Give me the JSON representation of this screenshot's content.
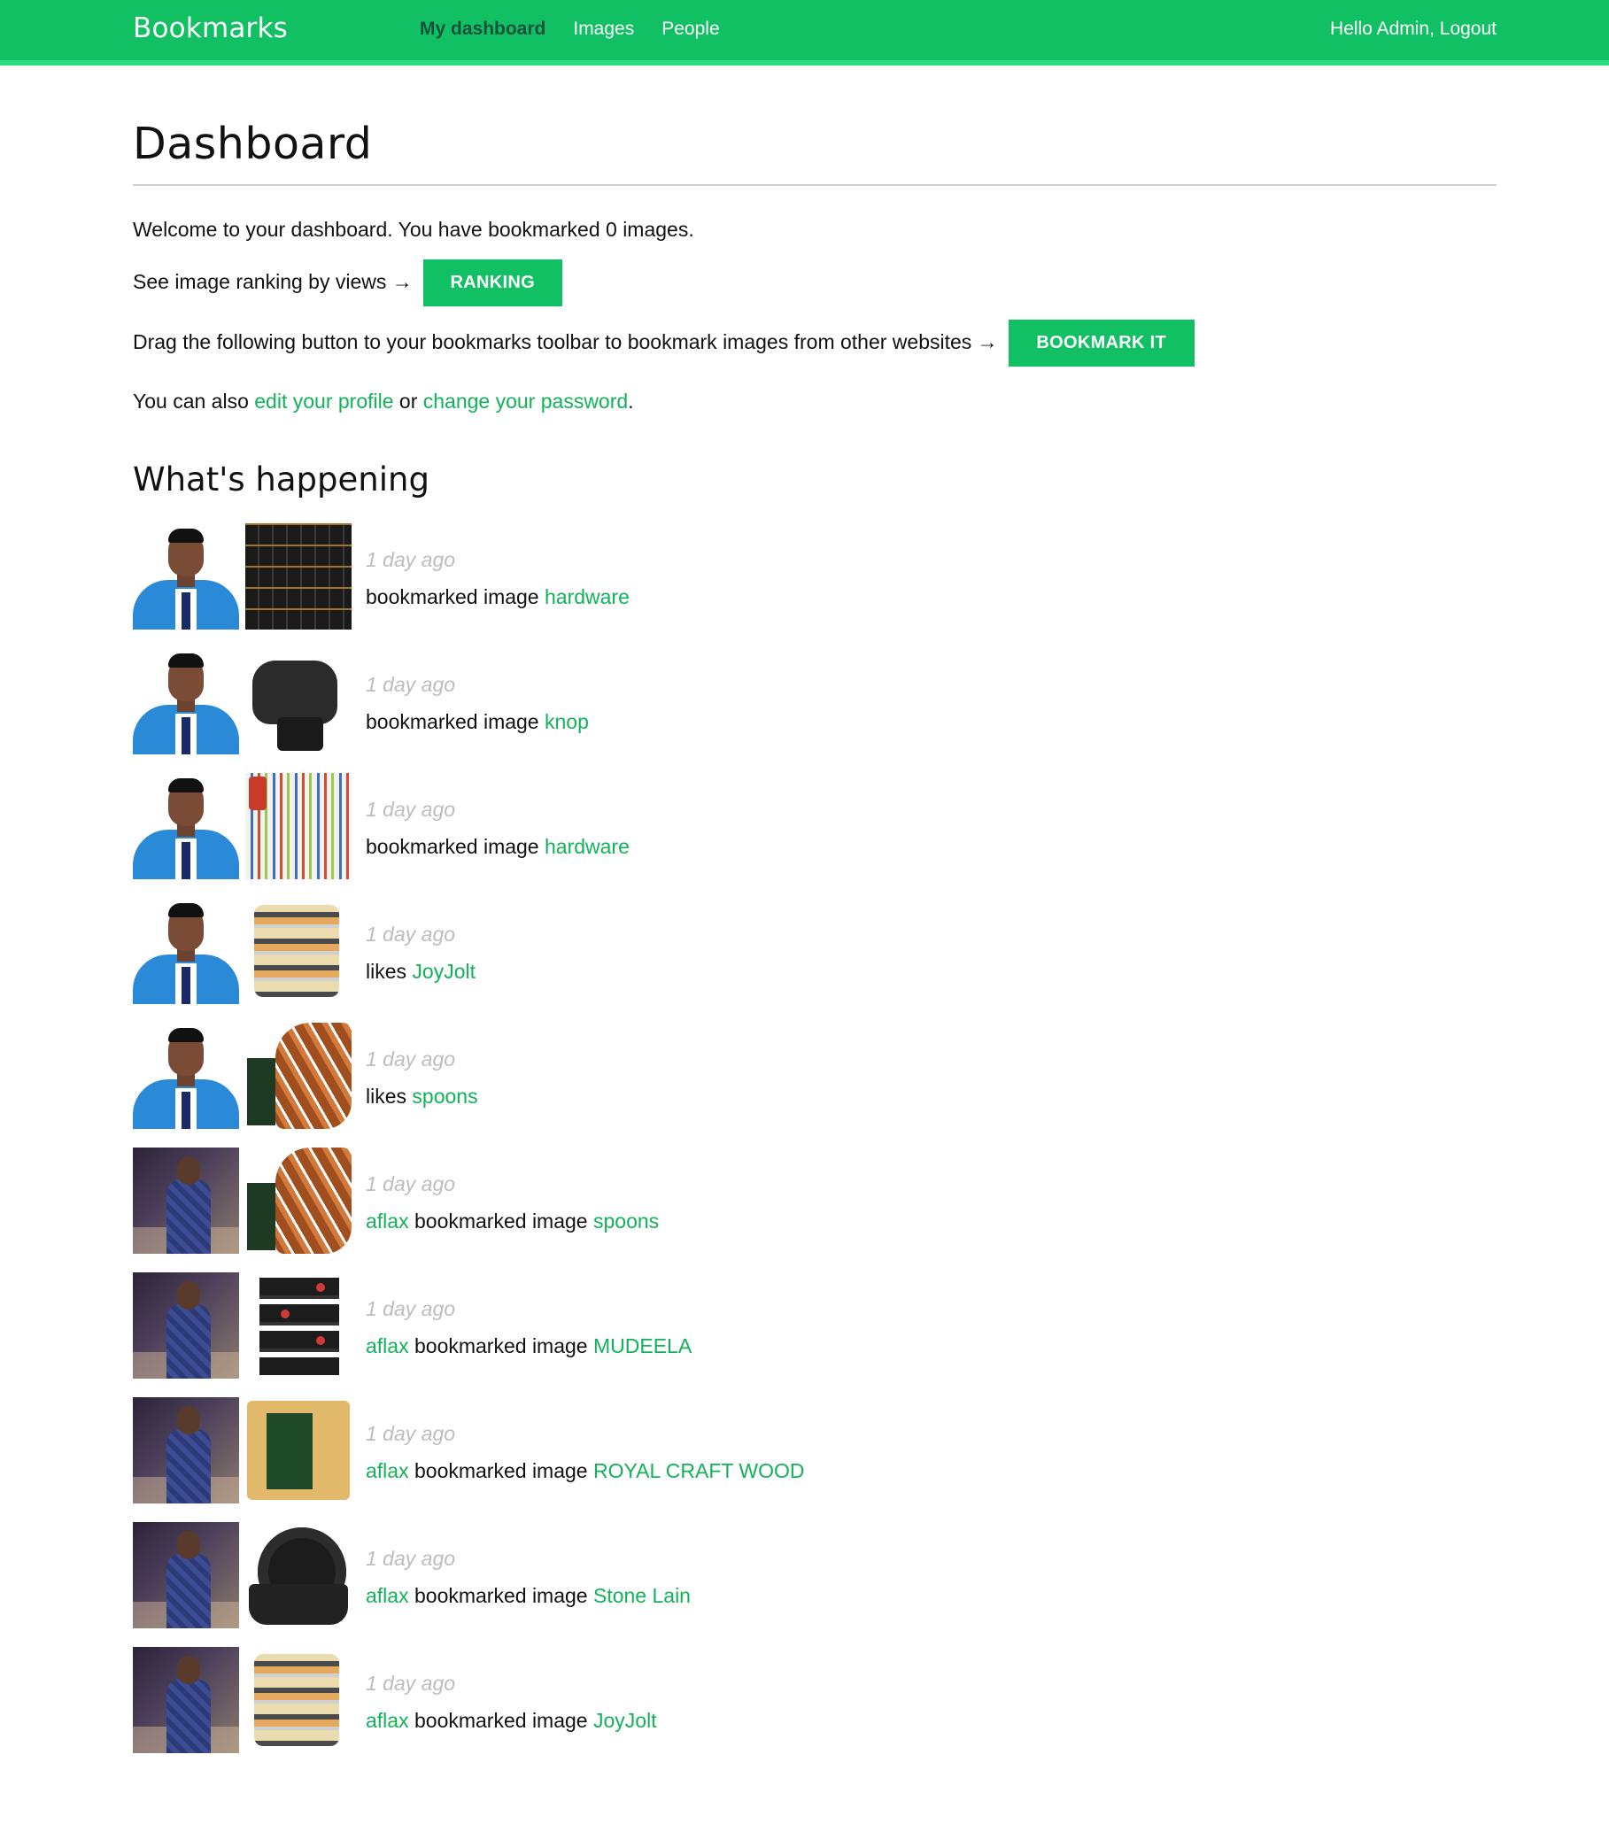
{
  "header": {
    "logo": "Bookmarks",
    "nav": [
      "My dashboard",
      "Images",
      "People"
    ],
    "greeting": "Hello Admin,",
    "logout": "Logout"
  },
  "colors": {
    "brand": "#12c064",
    "link": "#12b259",
    "muted": "#bdbdbd"
  },
  "page": {
    "title": "Dashboard",
    "welcome": "Welcome to your dashboard. You have bookmarked 0 images.",
    "ranking_text": "See image ranking by views →",
    "ranking_button": "RANKING",
    "bookmarklet_text": "Drag the following button to your bookmarks toolbar to bookmark images from other websites →",
    "bookmarklet_button": "BOOKMARK IT",
    "links_prefix": "You can also",
    "edit_profile": "edit your profile",
    "links_or": "or",
    "change_password": "change your password",
    "links_suffix": "."
  },
  "activity": {
    "title": "What's happening",
    "items": [
      {
        "time": "1 day ago",
        "user": "",
        "verb": "bookmarked image",
        "target": "hardware",
        "avatar": "suit",
        "thumb": "hardware1"
      },
      {
        "time": "1 day ago",
        "user": "",
        "verb": "bookmarked image",
        "target": "knop",
        "avatar": "suit",
        "thumb": "knob"
      },
      {
        "time": "1 day ago",
        "user": "",
        "verb": "bookmarked image",
        "target": "hardware",
        "avatar": "suit",
        "thumb": "hardware2"
      },
      {
        "time": "1 day ago",
        "user": "",
        "verb": "likes",
        "target": "JoyJolt",
        "avatar": "suit",
        "thumb": "containers"
      },
      {
        "time": "1 day ago",
        "user": "",
        "verb": "likes",
        "target": "spoons",
        "avatar": "suit",
        "thumb": "spoons"
      },
      {
        "time": "1 day ago",
        "user": "aflax",
        "verb": "bookmarked image",
        "target": "spoons",
        "avatar": "plaid",
        "thumb": "spoons"
      },
      {
        "time": "1 day ago",
        "user": "aflax",
        "verb": "bookmarked image",
        "target": "MUDEELA",
        "avatar": "plaid",
        "thumb": "rack"
      },
      {
        "time": "1 day ago",
        "user": "aflax",
        "verb": "bookmarked image",
        "target": "ROYAL CRAFT WOOD",
        "avatar": "plaid",
        "thumb": "board"
      },
      {
        "time": "1 day ago",
        "user": "aflax",
        "verb": "bookmarked image",
        "target": "Stone Lain",
        "avatar": "plaid",
        "thumb": "plates"
      },
      {
        "time": "1 day ago",
        "user": "aflax",
        "verb": "bookmarked image",
        "target": "JoyJolt",
        "avatar": "plaid",
        "thumb": "containers"
      }
    ]
  }
}
